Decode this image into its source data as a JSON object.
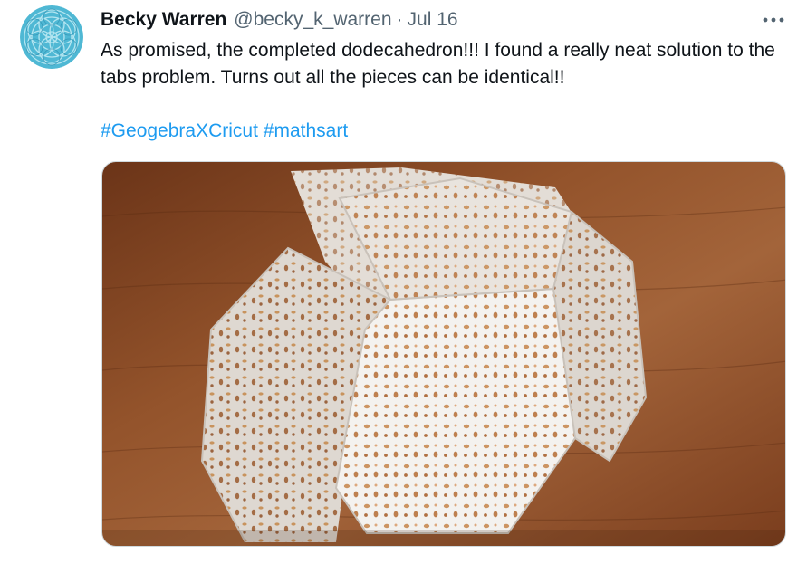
{
  "tweet": {
    "display_name": "Becky Warren",
    "handle": "@becky_k_warren",
    "separator": "·",
    "date": "Jul 16",
    "text": "As promised, the completed dodecahedron!!! I found a really neat solution to the tabs problem. Turns out all the pieces can be identical!!",
    "hashtags": [
      "#GeogebraXCricut",
      "#mathsart"
    ],
    "avatar_icon": "mandala-avatar-icon",
    "more_icon": "more-options-icon",
    "media_description_icon": "photo"
  },
  "colors": {
    "text_primary": "#0f1419",
    "text_secondary": "#536471",
    "link": "#1d9bf0",
    "avatar_bg": "#4fb8d4",
    "wood": "#8a4a26",
    "paper": "#eeebe6"
  }
}
